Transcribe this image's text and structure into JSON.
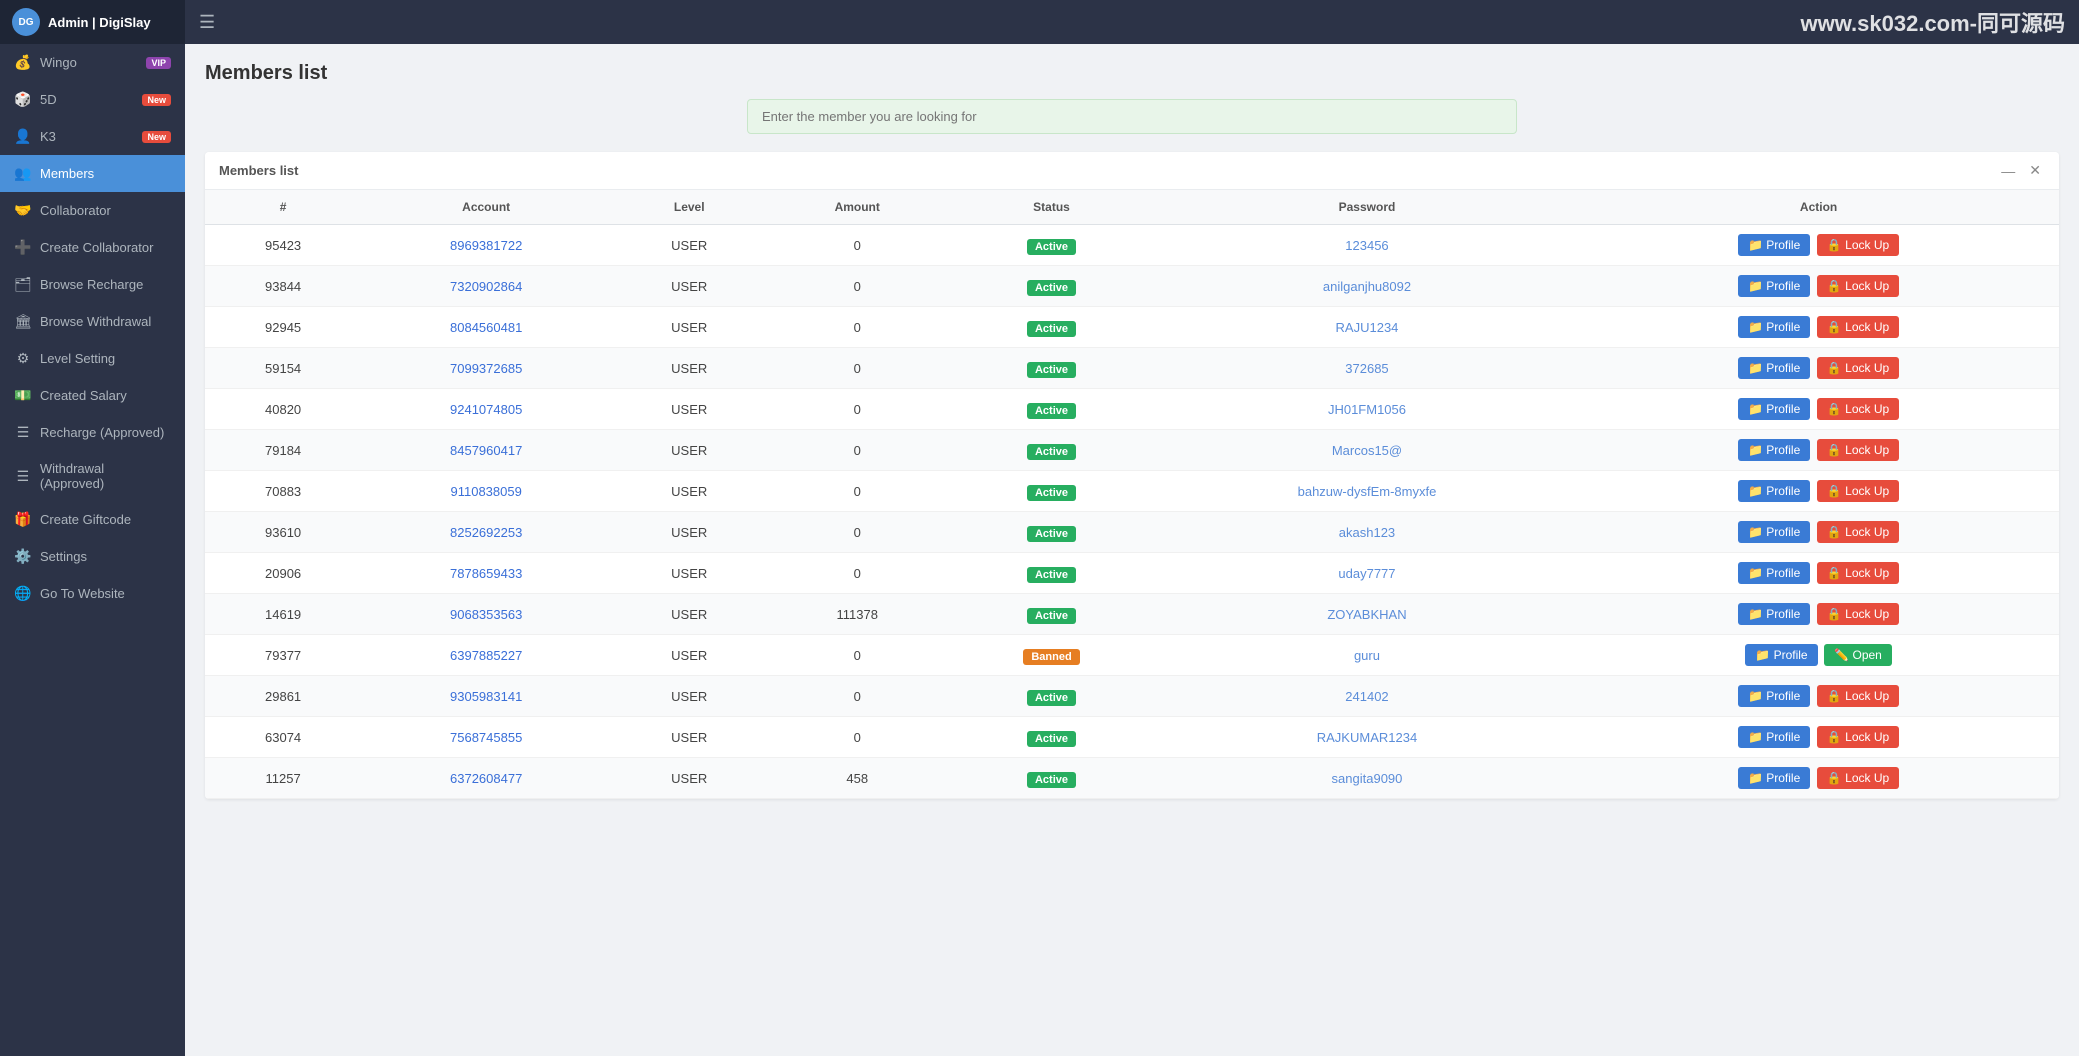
{
  "sidebar": {
    "header": {
      "title": "Admin | DigiSlay",
      "logo": "DG"
    },
    "items": [
      {
        "id": "wingo",
        "label": "Wingo",
        "icon": "💰",
        "badge": "VIP",
        "badgeClass": "badge-vip"
      },
      {
        "id": "5d",
        "label": "5D",
        "icon": "🎲",
        "badge": "New",
        "badgeClass": "badge-new"
      },
      {
        "id": "k3",
        "label": "K3",
        "icon": "👤",
        "badge": "New",
        "badgeClass": "badge-new"
      },
      {
        "id": "members",
        "label": "Members",
        "icon": "👥",
        "badge": "",
        "badgeClass": "",
        "active": true
      },
      {
        "id": "collaborator",
        "label": "Collaborator",
        "icon": "🤝",
        "badge": "",
        "badgeClass": ""
      },
      {
        "id": "create-collaborator",
        "label": "Create Collaborator",
        "icon": "➕",
        "badge": "",
        "badgeClass": ""
      },
      {
        "id": "browse-recharge",
        "label": "Browse Recharge",
        "icon": "🗂",
        "badge": "",
        "badgeClass": ""
      },
      {
        "id": "browse-withdrawal",
        "label": "Browse Withdrawal",
        "icon": "🏛",
        "badge": "",
        "badgeClass": ""
      },
      {
        "id": "level-setting",
        "label": "Level Setting",
        "icon": "⚙",
        "badge": "",
        "badgeClass": ""
      },
      {
        "id": "created-salary",
        "label": "Created Salary",
        "icon": "💵",
        "badge": "",
        "badgeClass": ""
      },
      {
        "id": "recharge-approved",
        "label": "Recharge (Approved)",
        "icon": "☰",
        "badge": "",
        "badgeClass": ""
      },
      {
        "id": "withdrawal-approved",
        "label": "Withdrawal (Approved)",
        "icon": "☰",
        "badge": "",
        "badgeClass": ""
      },
      {
        "id": "create-giftcode",
        "label": "Create Giftcode",
        "icon": "🎁",
        "badge": "",
        "badgeClass": ""
      },
      {
        "id": "settings",
        "label": "Settings",
        "icon": "⚙️",
        "badge": "",
        "badgeClass": ""
      },
      {
        "id": "go-to-website",
        "label": "Go To Website",
        "icon": "🌐",
        "badge": "",
        "badgeClass": ""
      }
    ]
  },
  "topbar": {
    "watermark": "www.sk032.com-同可源码"
  },
  "page": {
    "title": "Members list",
    "search_placeholder": "Enter the member you are looking for",
    "table_title": "Members list"
  },
  "table": {
    "columns": [
      "#",
      "Account",
      "Level",
      "Amount",
      "Status",
      "Password",
      "Action"
    ],
    "rows": [
      {
        "id": "95423",
        "account": "8969381722",
        "level": "USER",
        "amount": "0",
        "status": "Active",
        "statusClass": "badge-active",
        "password": "123456",
        "action1": "Profile",
        "action2": "Lock Up",
        "action2Class": "btn-lockup"
      },
      {
        "id": "93844",
        "account": "7320902864",
        "level": "USER",
        "amount": "0",
        "status": "Active",
        "statusClass": "badge-active",
        "password": "anilganjhu8092",
        "action1": "Profile",
        "action2": "Lock Up",
        "action2Class": "btn-lockup"
      },
      {
        "id": "92945",
        "account": "8084560481",
        "level": "USER",
        "amount": "0",
        "status": "Active",
        "statusClass": "badge-active",
        "password": "RAJU1234",
        "action1": "Profile",
        "action2": "Lock Up",
        "action2Class": "btn-lockup"
      },
      {
        "id": "59154",
        "account": "7099372685",
        "level": "USER",
        "amount": "0",
        "status": "Active",
        "statusClass": "badge-active",
        "password": "372685",
        "action1": "Profile",
        "action2": "Lock Up",
        "action2Class": "btn-lockup"
      },
      {
        "id": "40820",
        "account": "9241074805",
        "level": "USER",
        "amount": "0",
        "status": "Active",
        "statusClass": "badge-active",
        "password": "JH01FM1056",
        "action1": "Profile",
        "action2": "Lock Up",
        "action2Class": "btn-lockup"
      },
      {
        "id": "79184",
        "account": "8457960417",
        "level": "USER",
        "amount": "0",
        "status": "Active",
        "statusClass": "badge-active",
        "password": "Marcos15@",
        "action1": "Profile",
        "action2": "Lock Up",
        "action2Class": "btn-lockup"
      },
      {
        "id": "70883",
        "account": "9110838059",
        "level": "USER",
        "amount": "0",
        "status": "Active",
        "statusClass": "badge-active",
        "password": "bahzuw-dysfEm-8myxfe",
        "action1": "Profile",
        "action2": "Lock Up",
        "action2Class": "btn-lockup"
      },
      {
        "id": "93610",
        "account": "8252692253",
        "level": "USER",
        "amount": "0",
        "status": "Active",
        "statusClass": "badge-active",
        "password": "akash123",
        "action1": "Profile",
        "action2": "Lock Up",
        "action2Class": "btn-lockup"
      },
      {
        "id": "20906",
        "account": "7878659433",
        "level": "USER",
        "amount": "0",
        "status": "Active",
        "statusClass": "badge-active",
        "password": "uday7777",
        "action1": "Profile",
        "action2": "Lock Up",
        "action2Class": "btn-lockup"
      },
      {
        "id": "14619",
        "account": "9068353563",
        "level": "USER",
        "amount": "111378",
        "status": "Active",
        "statusClass": "badge-active",
        "password": "ZOYABKHAN",
        "action1": "Profile",
        "action2": "Lock Up",
        "action2Class": "btn-lockup"
      },
      {
        "id": "79377",
        "account": "6397885227",
        "level": "USER",
        "amount": "0",
        "status": "Banned",
        "statusClass": "badge-banned",
        "password": "guru",
        "action1": "Profile",
        "action2": "Open",
        "action2Class": "btn-open"
      },
      {
        "id": "29861",
        "account": "9305983141",
        "level": "USER",
        "amount": "0",
        "status": "Active",
        "statusClass": "badge-active",
        "password": "241402",
        "action1": "Profile",
        "action2": "Lock Up",
        "action2Class": "btn-lockup"
      },
      {
        "id": "63074",
        "account": "7568745855",
        "level": "USER",
        "amount": "0",
        "status": "Active",
        "statusClass": "badge-active",
        "password": "RAJKUMAR1234",
        "action1": "Profile",
        "action2": "Lock Up",
        "action2Class": "btn-lockup"
      },
      {
        "id": "11257",
        "account": "6372608477",
        "level": "USER",
        "amount": "458",
        "status": "Active",
        "statusClass": "badge-active",
        "password": "sangita9090",
        "action1": "Profile",
        "action2": "Lock Up",
        "action2Class": "btn-lockup"
      }
    ]
  },
  "buttons": {
    "profile": "📁 Profile",
    "lockup": "🔒 Lock Up",
    "open": "✏️ Open"
  }
}
